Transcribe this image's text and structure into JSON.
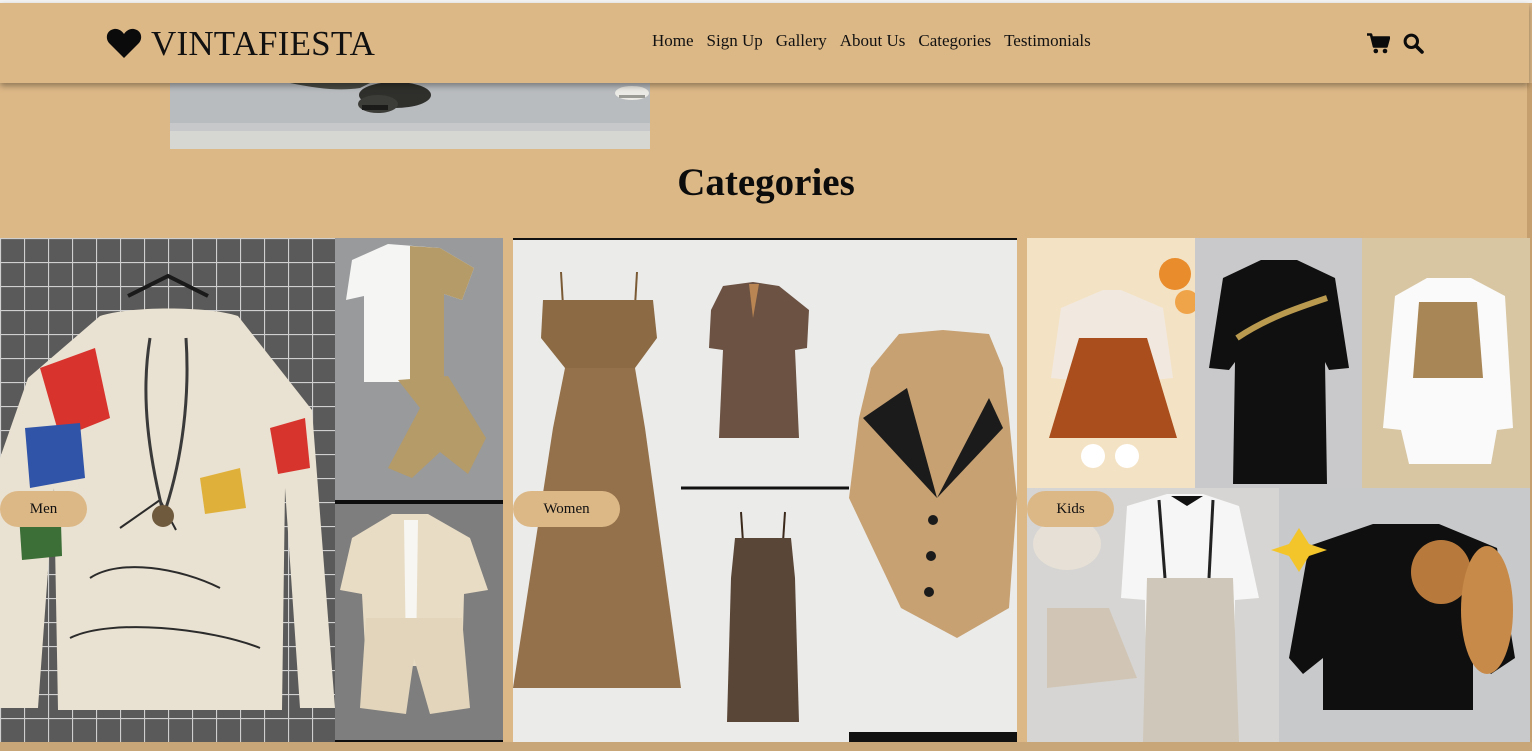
{
  "header": {
    "brand": "VINTAFIESTA",
    "logo_icon": "heart-icon",
    "nav": [
      "Home",
      "Sign Up",
      "Gallery",
      "About Us",
      "Categories",
      "Testimonials"
    ],
    "icons": [
      "cart-icon",
      "search-icon"
    ]
  },
  "main": {
    "title": "Categories",
    "categories": [
      {
        "label": "Men"
      },
      {
        "label": "Women"
      },
      {
        "label": "Kids"
      }
    ]
  },
  "colors": {
    "accent": "#DDB887",
    "text": "#111111"
  }
}
